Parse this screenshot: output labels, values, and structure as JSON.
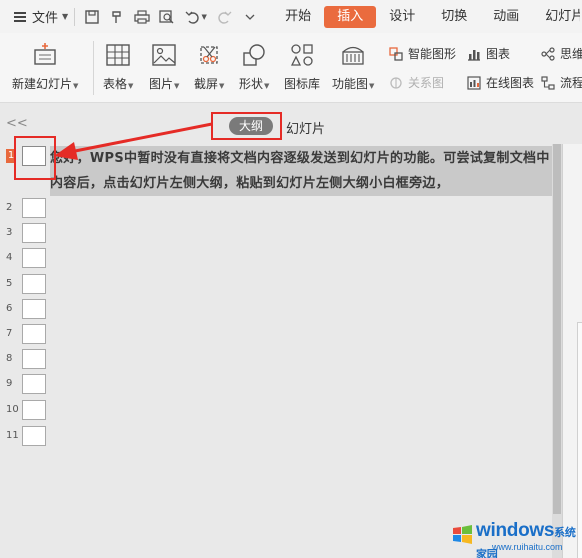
{
  "menubar": {
    "file_label": "文件",
    "tabs": [
      "开始",
      "插入",
      "设计",
      "切换",
      "动画",
      "幻灯片放"
    ],
    "active_tab": "插入",
    "accent_color": "#ea6b3e"
  },
  "ribbon": {
    "new_slide": "新建幻灯片",
    "table": "表格",
    "picture": "图片",
    "screenshot": "截屏",
    "shape": "形状",
    "icon_lib": "图标库",
    "feature_pic": "功能图",
    "smart_shape": "智能图形",
    "chart": "图表",
    "mind": "思维",
    "relation": "关系图",
    "online_chart": "在线图表",
    "flow": "流程"
  },
  "panel": {
    "outline_button": "大纲",
    "slides_label": "幻灯片",
    "collapse_glyph": "<<"
  },
  "outline": {
    "text": "您好，WPS中暂时没有直接将文档内容逐级发送到幻灯片的功能。可尝试复制文档中内容后，点击幻灯片左侧大纲，粘贴到幻灯片左侧大纲小白框旁边，",
    "rows": [
      "1",
      "2",
      "3",
      "4",
      "5",
      "6",
      "7",
      "8",
      "9",
      "10",
      "11"
    ]
  },
  "watermark": {
    "brand": "windows",
    "suffix": "系统家园",
    "url": "www.ruihaitu.com"
  }
}
